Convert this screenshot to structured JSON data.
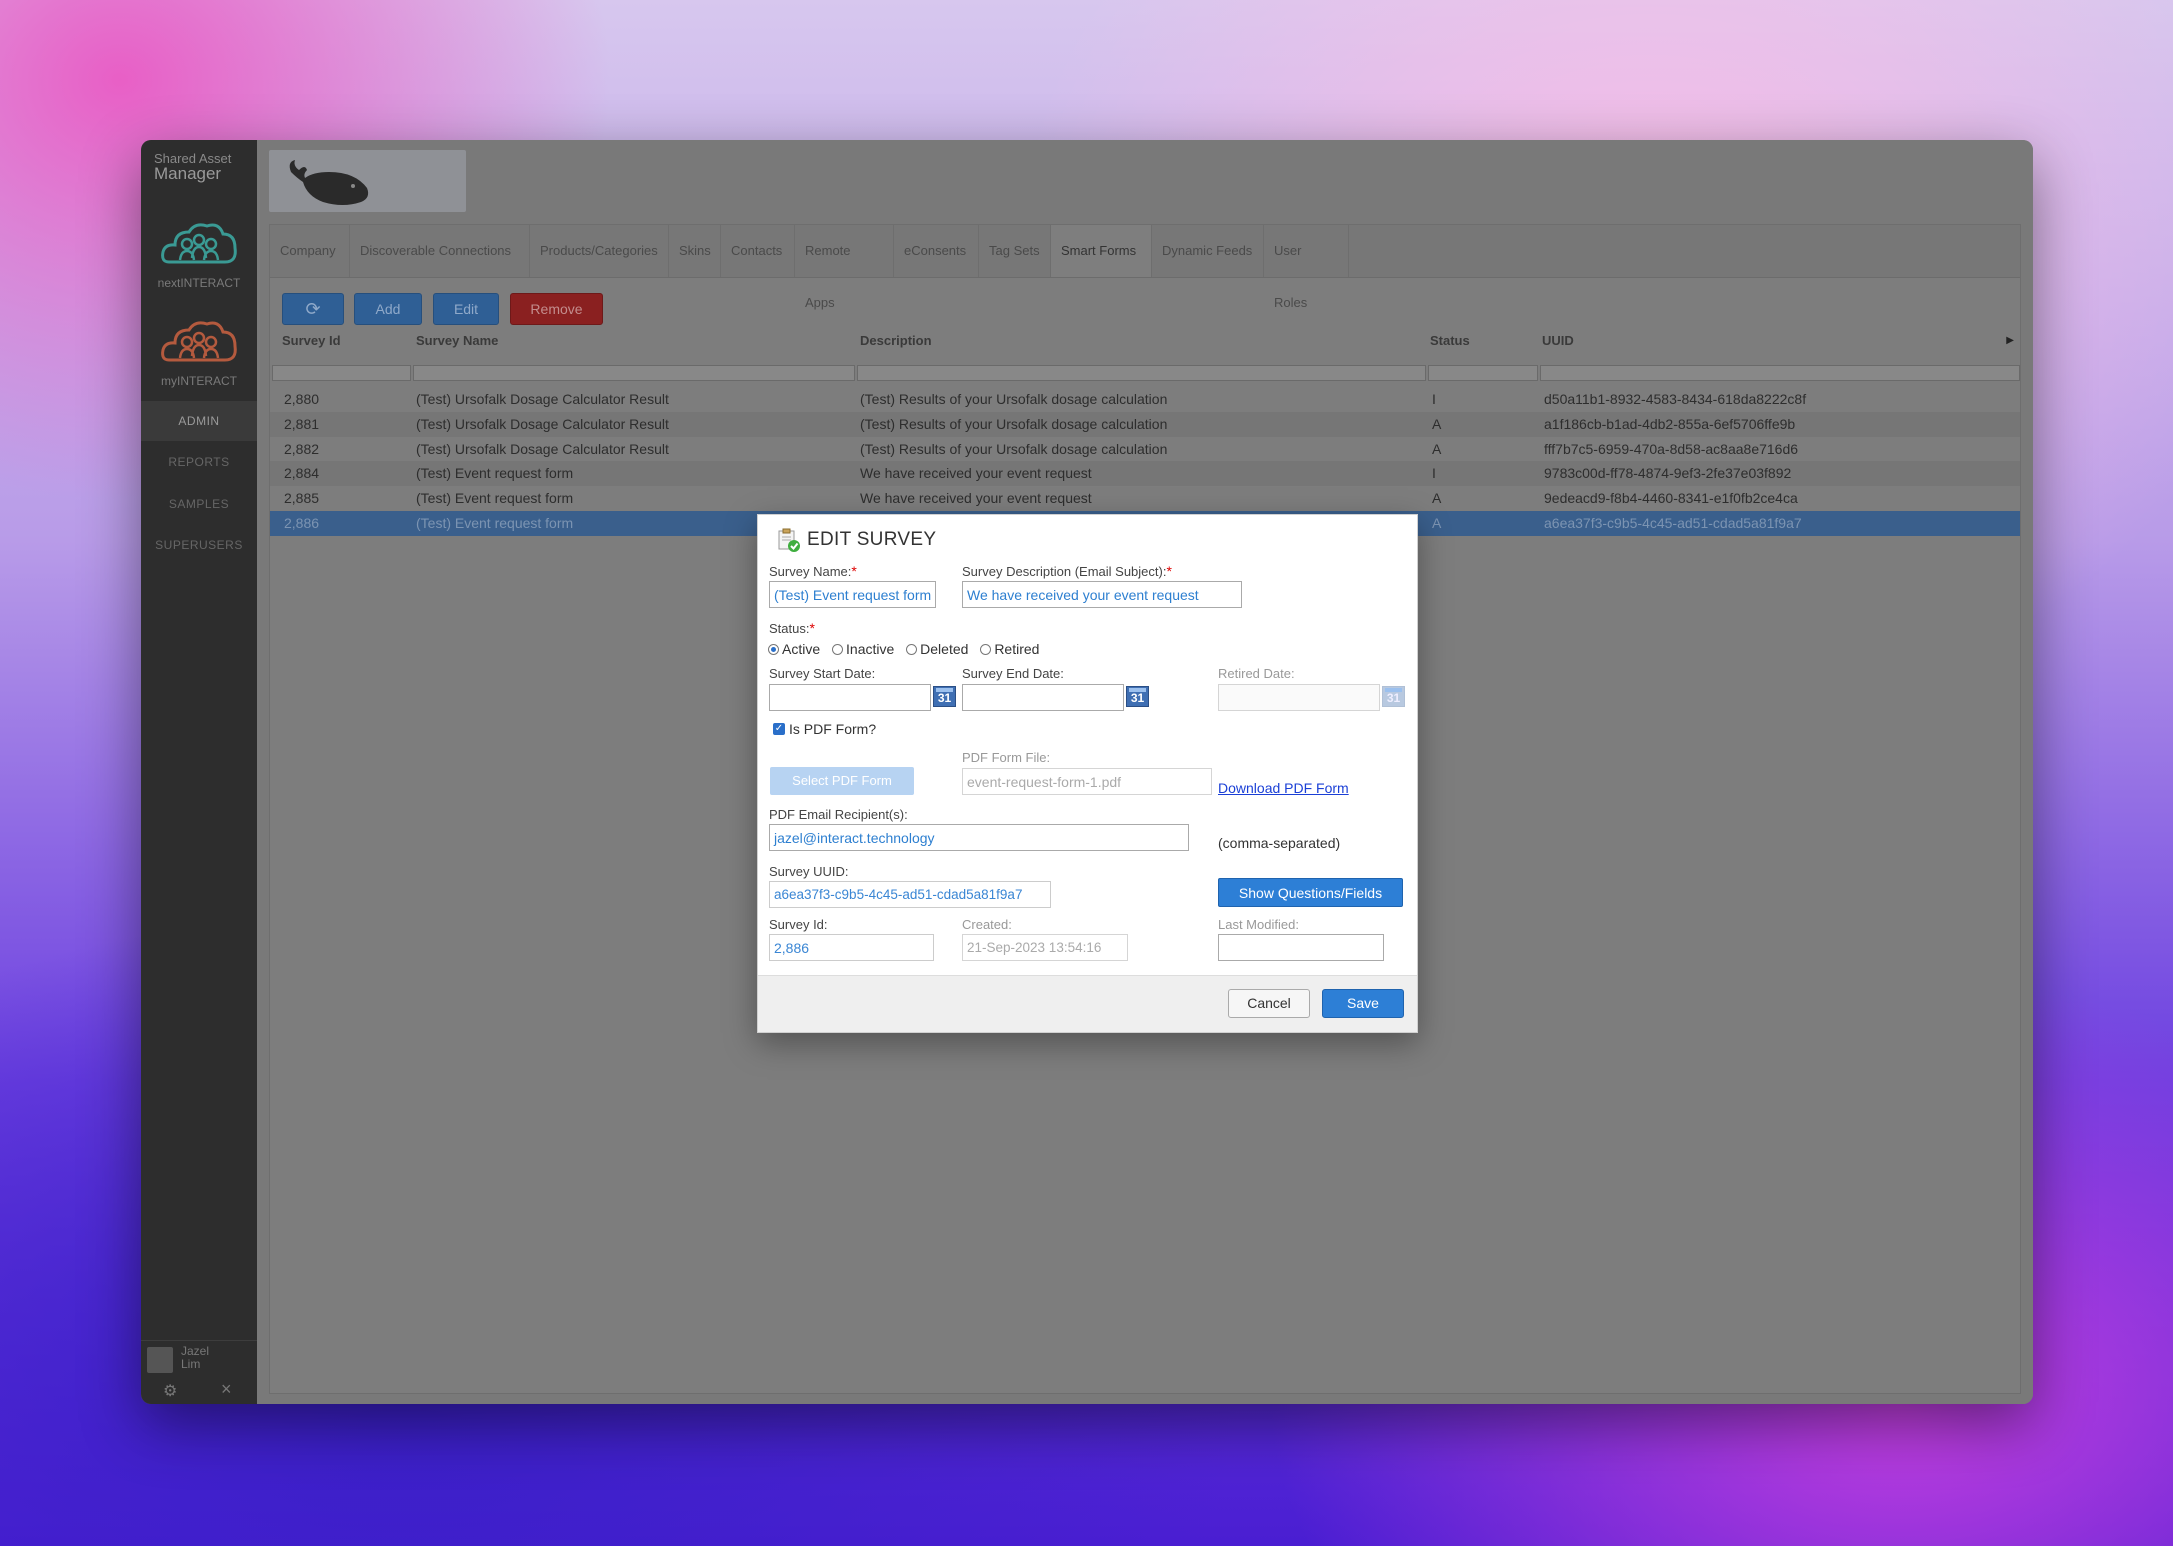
{
  "app": {
    "brand_top": "Shared Asset",
    "brand_bottom": "Manager"
  },
  "sidebar": {
    "brands": [
      {
        "label": "nextINTERACT",
        "color": "#3a9a94"
      },
      {
        "label": "myINTERACT",
        "color": "#b45a3e"
      }
    ],
    "nav": [
      "ADMIN",
      "REPORTS",
      "SAMPLES",
      "SUPERUSERS"
    ],
    "user": {
      "first": "Jazel",
      "last": "Lim"
    }
  },
  "tabs": [
    "Company",
    "Discoverable Connections",
    "Products/Categories",
    "Skins",
    "Contacts",
    "Remote Apps",
    "eConsents",
    "Tag Sets",
    "Smart Forms",
    "Dynamic Feeds",
    "User Roles"
  ],
  "active_tab": "Smart Forms",
  "toolbar": {
    "add": "Add",
    "edit": "Edit",
    "remove": "Remove",
    "refresh_icon": "refresh-icon"
  },
  "grid": {
    "columns": [
      "Survey Id",
      "Survey Name",
      "Description",
      "Status",
      "UUID"
    ],
    "rows": [
      [
        "2,880",
        "(Test) Ursofalk Dosage Calculator Result",
        "(Test) Results of your Ursofalk dosage calculation",
        "I",
        "d50a11b1-8932-4583-8434-618da8222c8f"
      ],
      [
        "2,881",
        "(Test) Ursofalk Dosage Calculator Result",
        "(Test) Results of your Ursofalk dosage calculation",
        "A",
        "a1f186cb-b1ad-4db2-855a-6ef5706ffe9b"
      ],
      [
        "2,882",
        "(Test) Ursofalk Dosage Calculator Result",
        "(Test) Results of your Ursofalk dosage calculation",
        "A",
        "fff7b7c5-6959-470a-8d58-ac8aa8e716d6"
      ],
      [
        "2,884",
        "(Test) Event request form",
        "We have received your event request",
        "I",
        "9783c00d-ff78-4874-9ef3-2fe37e03f892"
      ],
      [
        "2,885",
        "(Test) Event request form",
        "We have received your event request",
        "A",
        "9edeacd9-f8b4-4460-8341-e1f0fb2ce4ca"
      ],
      [
        "2,886",
        "(Test) Event request form",
        "",
        "A",
        "a6ea37f3-c9b5-4c45-ad51-cdad5a81f9a7"
      ]
    ]
  },
  "dialog": {
    "title": "EDIT SURVEY",
    "survey_name_label": "Survey Name:",
    "survey_name_value": "(Test) Event request form",
    "survey_desc_label": "Survey Description (Email Subject):",
    "survey_desc_value": "We have received your event request",
    "required_mark": "*",
    "status_label": "Status:",
    "status_options": [
      "Active",
      "Inactive",
      "Deleted",
      "Retired"
    ],
    "status_selected": "Active",
    "start_date_label": "Survey Start Date:",
    "end_date_label": "Survey End Date:",
    "retired_date_label": "Retired Date:",
    "calendar_glyph": "31",
    "is_pdf_label": "Is PDF Form?",
    "is_pdf_checked": true,
    "select_pdf_button": "Select PDF Form",
    "pdf_file_label": "PDF Form File:",
    "pdf_file_value": "event-request-form-1.pdf",
    "download_link": "Download PDF Form",
    "pdf_email_label": "PDF Email Recipient(s):",
    "pdf_email_value": "jazel@interact.technology",
    "comma_note": "(comma-separated)",
    "uuid_label": "Survey UUID:",
    "uuid_value": "a6ea37f3-c9b5-4c45-ad51-cdad5a81f9a7",
    "show_questions_button": "Show Questions/Fields",
    "survey_id_label": "Survey Id:",
    "survey_id_value": "2,886",
    "created_label": "Created:",
    "created_value": "21-Sep-2023 13:54:16",
    "last_modified_label": "Last Modified:",
    "cancel_button": "Cancel",
    "save_button": "Save"
  }
}
